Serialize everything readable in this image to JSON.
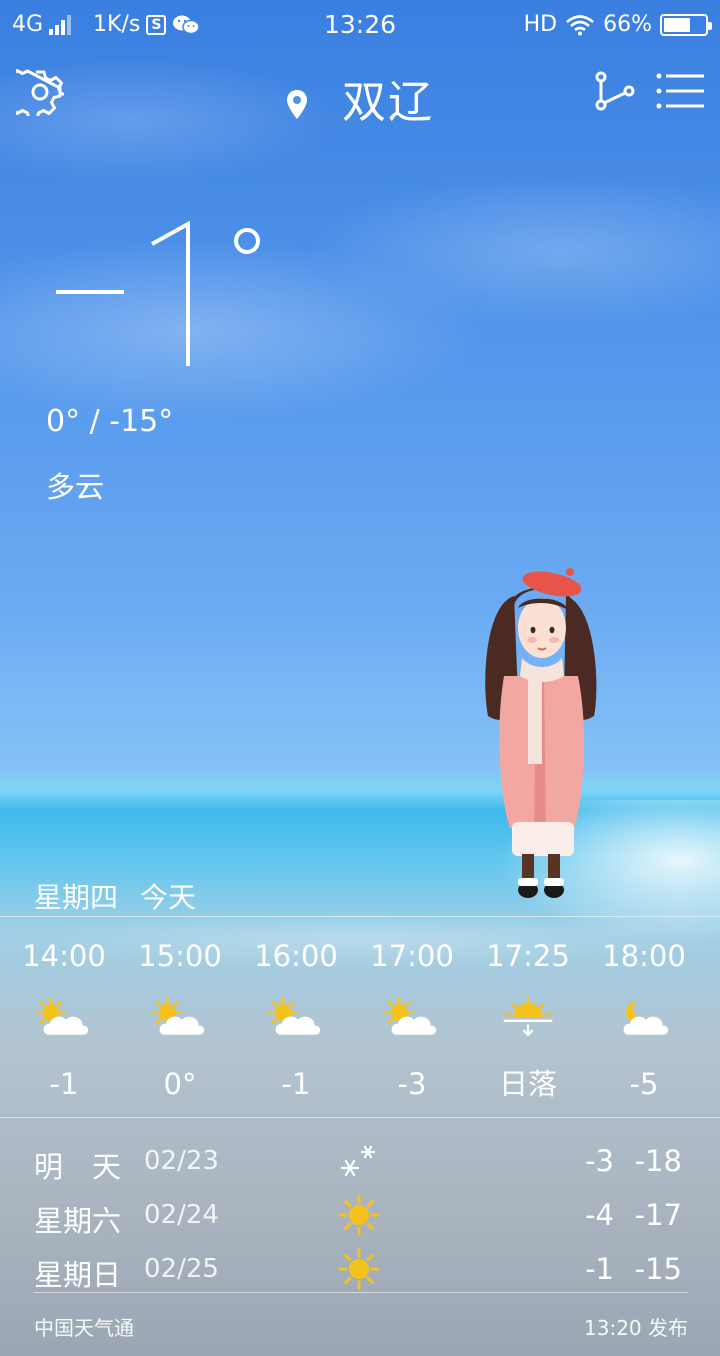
{
  "status_bar": {
    "network": "4G",
    "speed": "1K/s",
    "time": "13:26",
    "hd": "HD",
    "battery": "66%",
    "battery_level": 0.66
  },
  "header": {
    "city": "双辽"
  },
  "current": {
    "temperature": "-1",
    "degree": "°",
    "range": "0° / -15°",
    "condition": "多云"
  },
  "today": {
    "day": "星期四",
    "label": "今天"
  },
  "hourly": [
    {
      "time": "14:00",
      "icon": "partly-cloudy-icon",
      "temp": "-1"
    },
    {
      "time": "15:00",
      "icon": "partly-cloudy-icon",
      "temp": "0°"
    },
    {
      "time": "16:00",
      "icon": "partly-cloudy-icon",
      "temp": "-1"
    },
    {
      "time": "17:00",
      "icon": "partly-cloudy-icon",
      "temp": "-3"
    },
    {
      "time": "17:25",
      "icon": "sunset-icon",
      "temp": "日落"
    },
    {
      "time": "18:00",
      "icon": "partly-cloudy-night-icon",
      "temp": "-5"
    }
  ],
  "daily": [
    {
      "name": "明　天",
      "date": "02/23",
      "icon": "snow-icon",
      "high": "-3",
      "low": "-18"
    },
    {
      "name": "星期六",
      "date": "02/24",
      "icon": "sun-icon",
      "high": "-4",
      "low": "-17"
    },
    {
      "name": "星期日",
      "date": "02/25",
      "icon": "sun-icon",
      "high": "-1",
      "low": "-15"
    }
  ],
  "footer": {
    "source": "中国天气通",
    "published": "13:20 发布"
  },
  "colors": {
    "sun": "#f5c21b",
    "cloud": "#ffffff",
    "sky": "#3f88e4"
  }
}
